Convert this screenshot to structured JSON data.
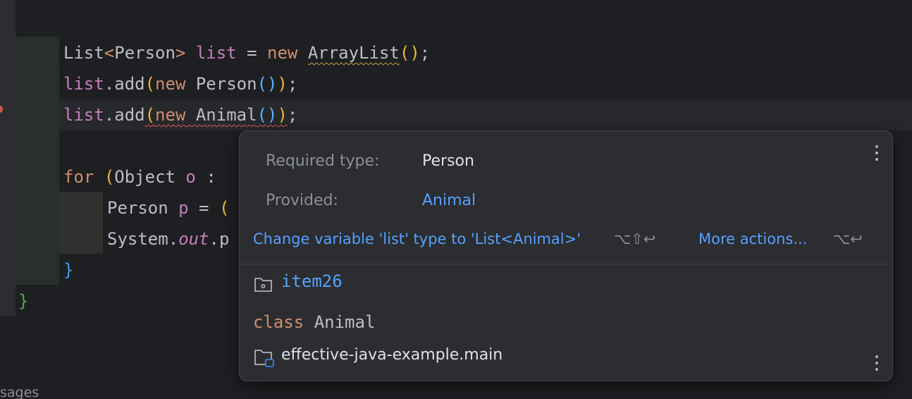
{
  "editor": {
    "lines": {
      "line1": {
        "type1": "List",
        "lt": "<",
        "type2": "Person",
        "gt": ">",
        "var": "list",
        "eq": " = ",
        "kw_new": "new",
        "type3": "ArrayList",
        "parens": "()",
        "semi": ";"
      },
      "line2": {
        "var": "list",
        "method": ".add",
        "open": "(",
        "kw_new": "new",
        "type": "Person",
        "inner": "()",
        "close": ")",
        "semi": ";"
      },
      "line3": {
        "var": "list",
        "method": ".add",
        "open": "(",
        "kw_new": "new",
        "type": "Animal",
        "inner": "()",
        "close": ")",
        "semi": ";"
      },
      "line4": {
        "kw_for": "for",
        "open": "(",
        "type": "Object",
        "var": "o",
        "colon": " :"
      },
      "line5": {
        "type": "Person",
        "var": "p",
        "eq": " = ",
        "open": "("
      },
      "line6": {
        "cls": "System",
        "dot": ".",
        "field": "out",
        "rest": ".p"
      },
      "line7": {
        "brace": "}"
      },
      "line8": {
        "brace": "}"
      }
    },
    "bottom_label": "sages"
  },
  "popup": {
    "required_label": "Required type:",
    "required_value": "Person",
    "provided_label": "Provided:",
    "provided_value": "Animal",
    "quick_fix": "Change variable 'list' type to 'List<Animal>'",
    "quick_fix_shortcut": "⌥⇧↩",
    "more_actions": "More actions...",
    "more_actions_shortcut": "⌥↩",
    "package": "item26",
    "class_kw": "class",
    "class_name": "Animal",
    "module": "effective-java-example.main"
  },
  "colors": {
    "accent_link": "#57a0ff",
    "keyword": "#cf8e6d",
    "error_underline": "#e0565c",
    "warning_underline": "#c9a634"
  }
}
